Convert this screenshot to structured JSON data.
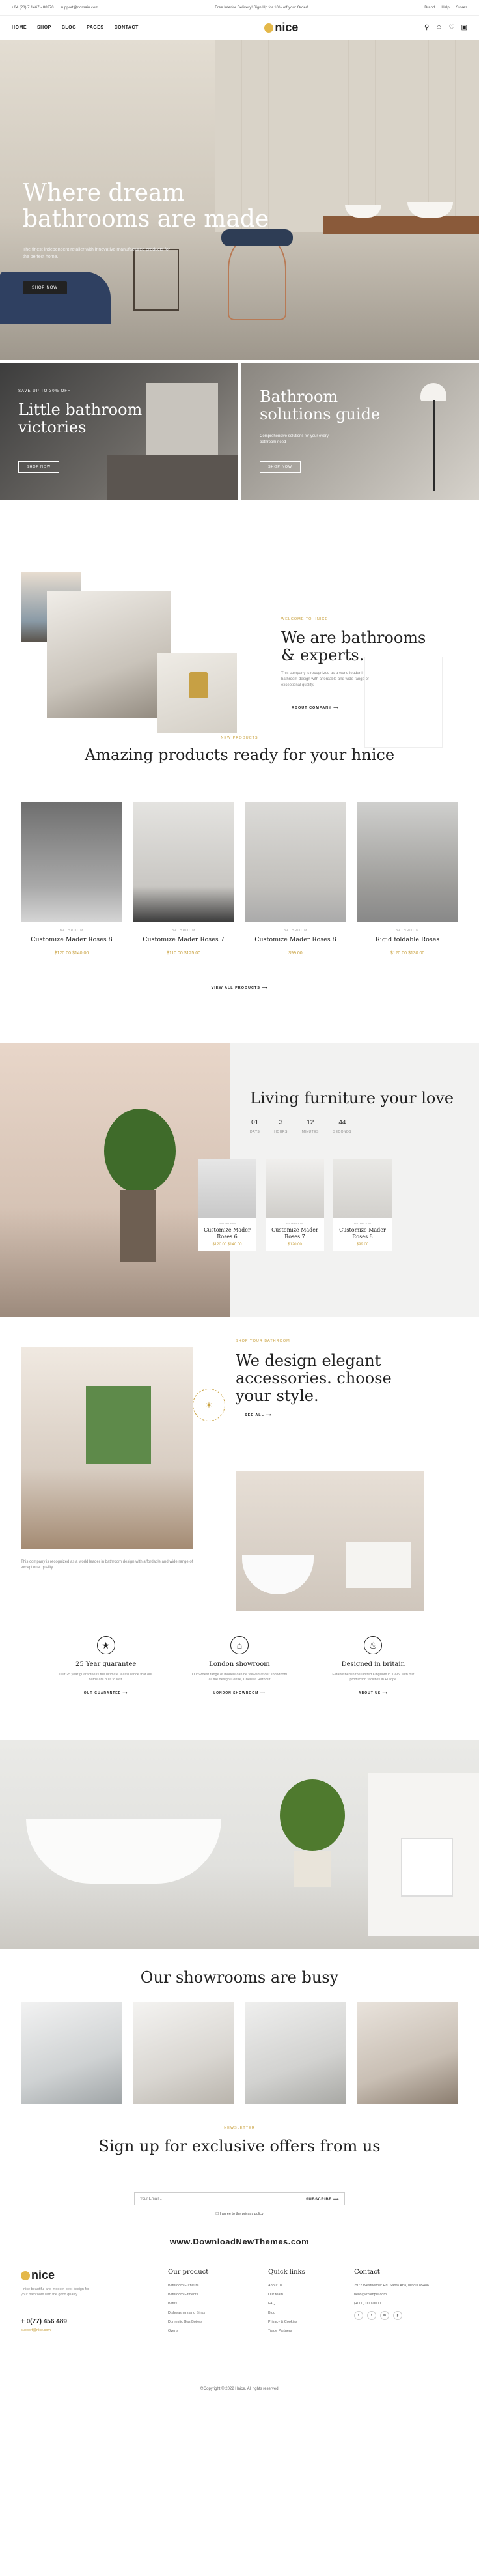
{
  "topbar": {
    "phone": "+84 (28) 7 1467 - 88970",
    "email": "support@domain.com",
    "promo": "Free Interior Delivery! Sign Up for 10% off your Order!",
    "links": [
      "Brand",
      "Help",
      "Stores"
    ]
  },
  "header": {
    "logo": "nice",
    "nav": [
      "HOME",
      "SHOP",
      "BLOG",
      "PAGES",
      "CONTACT"
    ]
  },
  "hero": {
    "title": "Where dream bathrooms are made",
    "desc": "The finest independent retailer with innovative manufactured products for the perfect home.",
    "button": "SHOP NOW"
  },
  "promo": {
    "card1": {
      "sub": "SAVE UP TO 30% OFF",
      "title": "Little bathroom victories",
      "button": "SHOP NOW"
    },
    "card2": {
      "title": "Bathroom solutions guide",
      "desc": "Comprehensive solutions for your every bathroom need",
      "button": "SHOP NOW"
    }
  },
  "about": {
    "sub": "WELCOME TO HNICE",
    "title": "We are bathrooms & experts.",
    "desc": "This company is recognized as a world leader in bathroom design with affordable and wide range of exceptional quality.",
    "link": "ABOUT COMPANY"
  },
  "products": {
    "sub": "NEW PRODUCTS",
    "title": "Amazing products ready for your hnice",
    "items": [
      {
        "cat": "BATHROOM",
        "name": "Customize Mader Roses 8",
        "price": "$120.00  $140.00"
      },
      {
        "cat": "BATHROOM",
        "name": "Customize Mader Roses 7",
        "price": "$110.00  $125.00"
      },
      {
        "cat": "BATHROOM",
        "name": "Customize Mader Roses 8",
        "price": "$99.00"
      },
      {
        "cat": "BATHROOM",
        "name": "Rigid foldable Roses",
        "price": "$120.00  $130.00"
      }
    ],
    "viewall": "VIEW ALL PRODUCTS"
  },
  "living": {
    "title": "Living furniture your love",
    "countdown": [
      {
        "n": "01",
        "l": "DAYS"
      },
      {
        "n": "3",
        "l": "HOURS"
      },
      {
        "n": "12",
        "l": "MINUTES"
      },
      {
        "n": "44",
        "l": "SECONDS"
      }
    ],
    "items": [
      {
        "cat": "BATHROOM",
        "name": "Customize Mader Roses 6",
        "price": "$120.00  $140.00"
      },
      {
        "cat": "BATHROOM",
        "name": "Customize Mader Roses 7",
        "price": "$120.00"
      },
      {
        "cat": "BATHROOM",
        "name": "Customize Mader Roses 8",
        "price": "$99.00"
      }
    ]
  },
  "accessories": {
    "sub": "SHOP YOUR BATHROOM",
    "title": "We design elegant accessories. choose your style.",
    "link": "SEE ALL",
    "desc": "This company is recognized as a world leader in bathroom design with affordable and wide range of exceptional quality."
  },
  "features": [
    {
      "icon": "badge-icon",
      "title": "25 Year guarantee",
      "desc": "Our 25 year guarantee is the ultimate reassurance that our baths are built to last.",
      "link": "OUR GUARANTEE"
    },
    {
      "icon": "store-icon",
      "title": "London showroom",
      "desc": "Our widest range of models can be viewed at our showroom all the design Centre, Chelsea Harbour",
      "link": "LONDON SHOWROOM"
    },
    {
      "icon": "bath-icon",
      "title": "Designed in britain",
      "desc": "Established in the United Kingdom in 1995, with our production facilities in Europe",
      "link": "ABOUT US"
    }
  ],
  "showrooms": {
    "title": "Our showrooms are busy"
  },
  "newsletter": {
    "sub": "NEWSLETTER",
    "title": "Sign up for exclusive offers from us",
    "placeholder": "Your Email...",
    "button": "SUBSCRIBE",
    "agree": "I agree to the privacy policy"
  },
  "watermark": "www.DownloadNewThemes.com",
  "footer": {
    "logo": "nice",
    "about": "Hnice beautiful and modern best design for your bathroom with the good quality.",
    "phone": "+ 0(77) 456 489",
    "email": "support@nice.com",
    "col1": {
      "title": "Our product",
      "items": [
        "Bathroom Furniture",
        "Bathroom Fitments",
        "Baths",
        "Dishwashers and Sinks",
        "Domestic Gas Boilers",
        "Ovens"
      ]
    },
    "col2": {
      "title": "Quick links",
      "items": [
        "About us",
        "Our team",
        "FAQ",
        "Blog",
        "Privacy & Cookies",
        "Trade Partners"
      ]
    },
    "col3": {
      "title": "Contact",
      "items": [
        "2972 Westheimer Rd. Santa Ana, Illinois 85486",
        "hello@example.com",
        "(+000) 000-0000"
      ],
      "social": [
        "f",
        "t",
        "in",
        "p"
      ]
    },
    "copyright": "@Copyright © 2022 Hnice. All rights reserved."
  }
}
